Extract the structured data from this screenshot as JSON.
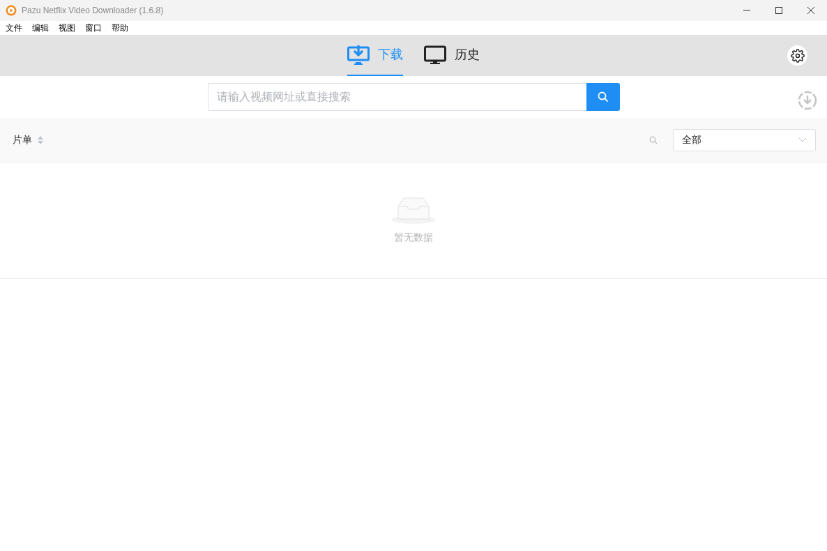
{
  "window": {
    "title": "Pazu Netflix Video Downloader (1.6.8)"
  },
  "menu": [
    "文件",
    "编辑",
    "视图",
    "窗口",
    "帮助"
  ],
  "tabs": [
    {
      "label": "下载",
      "kind": "download",
      "selected": true
    },
    {
      "label": "历史",
      "kind": "history",
      "selected": false
    }
  ],
  "search": {
    "placeholder": "请输入视频网址或直接搜索"
  },
  "table": {
    "column_1": "片单",
    "filter": "全部",
    "empty_text": "暂无数据"
  }
}
